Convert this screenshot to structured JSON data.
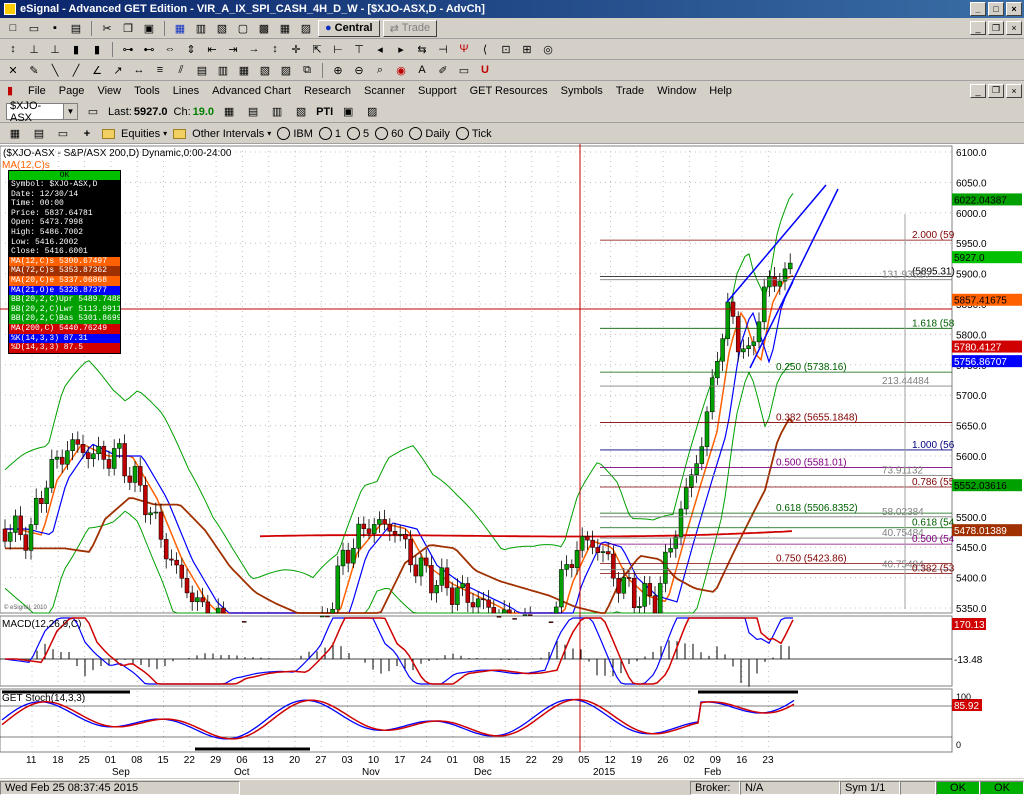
{
  "window": {
    "title": "eSignal - Advanced GET Edition - VIR_A_IX_SPI_CASH_4H_D_W - [$XJO-ASX,D - AdvCh]"
  },
  "toolbar": {
    "central_label": "Central",
    "trade_label": "Trade"
  },
  "menu": [
    "File",
    "Page",
    "View",
    "Tools",
    "Lines",
    "Advanced Chart",
    "Research",
    "Scanner",
    "Support",
    "GET Resources",
    "Symbols",
    "Trade",
    "Window",
    "Help"
  ],
  "symbolbar": {
    "symbol": "$XJO-ASX",
    "last_label": "Last:",
    "last_value": "5927.0",
    "ch_label": "Ch:",
    "ch_value": "19.0",
    "pti_label": "PTI"
  },
  "intervalbar": {
    "equities": "Equities",
    "other_intervals": "Other Intervals",
    "ibm": "IBM",
    "i1": "1",
    "i5": "5",
    "i60": "60",
    "daily": "Daily",
    "tick": "Tick"
  },
  "chart": {
    "header": "($XJO-ASX - S&P/ASX 200,D) Dynamic,0:00-24:00",
    "ma_label": "MA(12,C)s",
    "copyright": "© eSignal, 2010",
    "colors": {
      "up": "#00a000",
      "down": "#c00000",
      "ma12": "#ff6000",
      "ma21": "#0000ff",
      "ma20": "#ff6000",
      "ma200": "#d00000",
      "ma72": "#a03000",
      "bb": "#00a000",
      "fib": "#800000"
    },
    "price_axis": [
      "6100.0",
      "6050.0",
      "6000.0",
      "5950.0",
      "5900.0",
      "5850.0",
      "5800.0",
      "5750.0",
      "5700.0",
      "5650.0",
      "5600.0",
      "5550.0",
      "5500.0",
      "5450.0",
      "5400.0",
      "5350.0"
    ],
    "price_tags": [
      {
        "text": "6022.04387",
        "value": 6022,
        "bg": "#00a000",
        "fg": "#000"
      },
      {
        "text": "5927.0",
        "value": 5927,
        "bg": "#00c000",
        "fg": "#000"
      },
      {
        "text": "5857.41675",
        "value": 5857,
        "bg": "#ff6000",
        "fg": "#000"
      },
      {
        "text": "5780.4127",
        "value": 5780,
        "bg": "#d00000",
        "fg": "#fff"
      },
      {
        "text": "5756.86707",
        "value": 5756,
        "bg": "#0000ff",
        "fg": "#fff"
      },
      {
        "text": "5552.03616",
        "value": 5552,
        "bg": "#00a000",
        "fg": "#000"
      },
      {
        "text": "5478.01389",
        "value": 5478,
        "bg": "#a03000",
        "fg": "#fff"
      }
    ],
    "fib_labels": [
      {
        "text": "2.000 (59",
        "value": 5955,
        "color": "#800000"
      },
      {
        "text": "(5895.31)",
        "value": 5895,
        "color": "#000"
      },
      {
        "text": "131.93516",
        "value": 5890,
        "color": "#808080"
      },
      {
        "text": "1.618 (58",
        "value": 5810,
        "color": "#006000"
      },
      {
        "text": "0.250 (5738.16)",
        "value": 5738,
        "color": "#006000"
      },
      {
        "text": "213.44484",
        "value": 5715,
        "color": "#808080"
      },
      {
        "text": "0.382 (5655.1848)",
        "value": 5655,
        "color": "#800000"
      },
      {
        "text": "1.000 (56",
        "value": 5610,
        "color": "#000080"
      },
      {
        "text": "0.500 (5581.01)",
        "value": 5581,
        "color": "#800080"
      },
      {
        "text": "73.91132",
        "value": 5568,
        "color": "#808080"
      },
      {
        "text": "0.786 (55",
        "value": 5549,
        "color": "#800000"
      },
      {
        "text": "0.618 (5506.8352)",
        "value": 5506,
        "color": "#006000"
      },
      {
        "text": "58.02384",
        "value": 5500,
        "color": "#808080"
      },
      {
        "text": "0.618 (54",
        "value": 5482,
        "color": "#006000"
      },
      {
        "text": "40.75484",
        "value": 5465,
        "color": "#808080"
      },
      {
        "text": "0.500 (54",
        "value": 5455,
        "color": "#800080"
      },
      {
        "text": "0.750 (5423.86)",
        "value": 5423,
        "color": "#800000"
      },
      {
        "text": "40.75484",
        "value": 5413,
        "color": "#808080"
      },
      {
        "text": "0.382 (53",
        "value": 5407,
        "color": "#800000"
      }
    ],
    "date_axis": [
      "11",
      "18",
      "25",
      "01",
      "08",
      "15",
      "22",
      "29",
      "06",
      "13",
      "20",
      "27",
      "03",
      "10",
      "17",
      "24",
      "01",
      "08",
      "15",
      "22",
      "29",
      "05",
      "12",
      "19",
      "26",
      "02",
      "09",
      "16",
      "23"
    ],
    "month_axis": [
      "Sep",
      "Oct",
      "Nov",
      "Dec",
      "2015",
      "Feb"
    ]
  },
  "data_window": {
    "status": "OK",
    "rows": [
      {
        "text": "Symbol: $XJO-ASX,D",
        "bg": "#000",
        "fg": "#fff"
      },
      {
        "text": "Date: 12/30/14",
        "bg": "#000",
        "fg": "#fff"
      },
      {
        "text": "Time: 00:00",
        "bg": "#000",
        "fg": "#fff"
      },
      {
        "text": "Price: 5837.64781",
        "bg": "#000",
        "fg": "#fff"
      },
      {
        "text": "Open: 5473.7998",
        "bg": "#000",
        "fg": "#fff"
      },
      {
        "text": "High: 5486.7002",
        "bg": "#000",
        "fg": "#fff"
      },
      {
        "text": "Low: 5416.2002",
        "bg": "#000",
        "fg": "#fff"
      },
      {
        "text": "Close: 5416.6001",
        "bg": "#000",
        "fg": "#fff"
      },
      {
        "text": "MA(12,C)s 5300.67497",
        "bg": "#ff6000",
        "fg": "#fff"
      },
      {
        "text": "MA(72,C)s 5353.87362",
        "bg": "#a03000",
        "fg": "#fff"
      },
      {
        "text": "MA(20,C)e 5337.06868",
        "bg": "#ff6000",
        "fg": "#fff"
      },
      {
        "text": "MA(21,O)e 5328.87377",
        "bg": "#0000ff",
        "fg": "#fff"
      },
      {
        "text": "BB(20,2,C)Upr 5489.74881",
        "bg": "#00a000",
        "fg": "#fff"
      },
      {
        "text": "BB(20,2,C)Lwr 5113.99113",
        "bg": "#00a000",
        "fg": "#fff"
      },
      {
        "text": "BB(20,2,C)Bas 5301.86997",
        "bg": "#00a000",
        "fg": "#fff"
      },
      {
        "text": "MA(200,C) 5440.76249",
        "bg": "#d00000",
        "fg": "#fff"
      },
      {
        "text": "%K(14,3,3) 87.31",
        "bg": "#0000ff",
        "fg": "#fff"
      },
      {
        "text": "%D(14,3,3) 87.5",
        "bg": "#d00000",
        "fg": "#fff"
      }
    ]
  },
  "macd": {
    "label": "MACD(12,26,9,C)",
    "tag_top": "170.13",
    "tag_zero": "-13.48"
  },
  "stoch": {
    "label": "GET Stoch(14,3,3)",
    "tag": "85.92",
    "axis_top": "100",
    "axis_bottom": "0"
  },
  "statusbar": {
    "datetime": "Wed Feb 25 08:37:45 2015",
    "broker_label": "Broker:",
    "broker_value": "N/A",
    "sym": "Sym 1/1",
    "ok1": "OK",
    "ok2": "OK"
  }
}
